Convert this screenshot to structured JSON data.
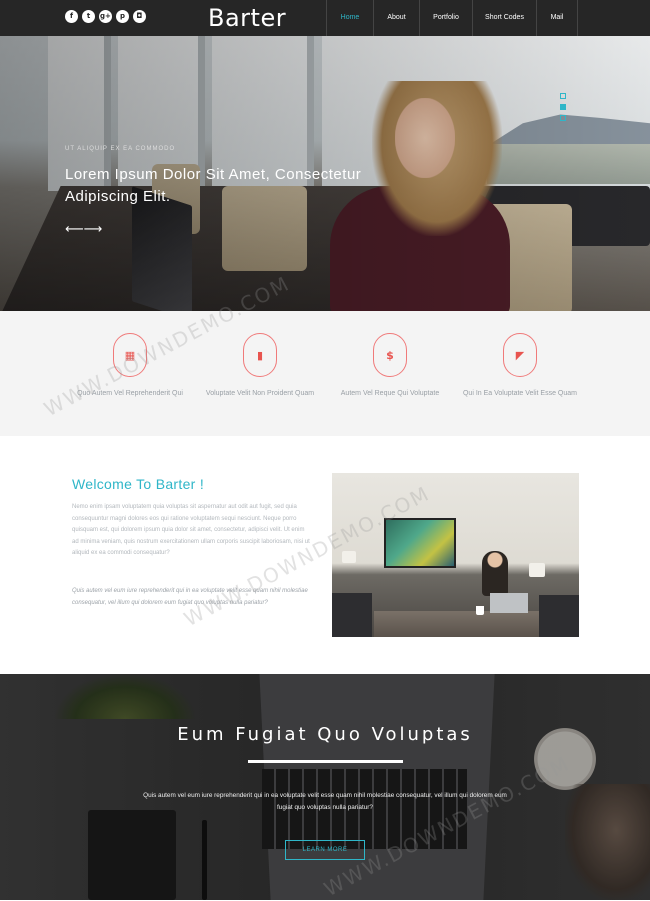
{
  "nav": {
    "brand": "Barter",
    "social": [
      {
        "name": "facebook-icon",
        "glyph": "f"
      },
      {
        "name": "twitter-icon",
        "glyph": "t"
      },
      {
        "name": "google-plus-icon",
        "glyph": "g+"
      },
      {
        "name": "pinterest-icon",
        "glyph": "p"
      },
      {
        "name": "instagram-icon",
        "glyph": "◘"
      }
    ],
    "menu": [
      "Home",
      "About",
      "Portfolio",
      "Short Codes",
      "Mail"
    ],
    "active_menu": "Home",
    "accent_color": "#2fb6c8"
  },
  "hero": {
    "kicker": "UT ALIQUIP EX EA COMMODO",
    "headline": "Lorem Ipsum Dolor Sit Amet, Consectetur Adipiscing Elit.",
    "arrows": "⟵⟶",
    "slide_indicators": 3,
    "active_slide": 2
  },
  "features": [
    {
      "icon": "calendar-icon",
      "glyph": "▦",
      "label": "Quo Autem Vel Reprehenderit Qui"
    },
    {
      "icon": "bar-chart-icon",
      "glyph": "▮",
      "label": "Voluptate Velit Non Proident Quam"
    },
    {
      "icon": "dollar-icon",
      "glyph": "$",
      "label": "Autem Vel Reque Qui Voluptate"
    },
    {
      "icon": "presentation-icon",
      "glyph": "◤",
      "label": "Qui In Ea Voluptate Velit Esse Quam"
    }
  ],
  "welcome": {
    "title": "Welcome To Barter !",
    "paragraph1": "Nemo enim ipsam voluptatem quia voluptas sit aspernatur aut odit aut fugit, sed quia consequuntur magni dolores eos qui ratione voluptatem sequi nesciunt. Neque porro quisquam est, qui dolorem ipsum quia dolor sit amet, consectetur, adipisci velit. Ut enim ad minima veniam, quis nostrum exercitationem ullam corporis suscipit laboriosam, nisi ut aliquid ex ea commodi consequatur?",
    "paragraph2": "Quis autem vel eum iure reprehenderit qui in ea voluptate velit esse quam nihil molestiae consequatur, vel illum qui dolorem eum fugiat quo voluptas nulla pariatur?"
  },
  "cta": {
    "title": "Eum Fugiat Quo Voluptas",
    "text": "Quis autem vel eum iure reprehenderit qui in ea voluptate velit esse quam nihil molestiae consequatur, vel illum qui dolorem eum fugiat quo voluptas nulla pariatur?",
    "button": "LEARN MORE"
  },
  "watermark": "WWW.DOWNDEMO.COM"
}
